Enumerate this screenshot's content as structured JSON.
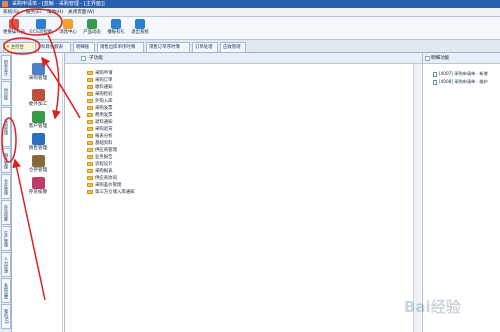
{
  "window": {
    "title": "采购申请单 - [蓝鲸 - 采购管理 - [主界面]]"
  },
  "menu": {
    "items": [
      "系统(S)",
      "服务(E)",
      "帮助(H)",
      "关闭页面(W)"
    ]
  },
  "toolbar": {
    "buttons": [
      {
        "label": "更换操作员",
        "icon": "user-switch-icon",
        "color": "#d9534f"
      },
      {
        "label": "ECS流程图",
        "icon": "flowchart-icon",
        "color": "#2c7fd1"
      },
      {
        "label": "消息中心",
        "icon": "message-icon",
        "color": "#f0a030"
      },
      {
        "label": "产品动态",
        "icon": "news-icon",
        "color": "#3a9a4a"
      },
      {
        "label": "播报有礼",
        "icon": "gift-icon",
        "color": "#2c7fd1"
      },
      {
        "label": "退出系统",
        "icon": "exit-icon",
        "color": "#2c7fd1"
      }
    ]
  },
  "tabs": [
    {
      "label": "主控台",
      "active": true
    },
    {
      "label": "科目余额表",
      "active": false
    },
    {
      "label": "明细账",
      "active": false
    },
    {
      "label": "销售出库单序时簿",
      "active": false
    },
    {
      "label": "销售订单序时簿",
      "active": false
    },
    {
      "label": "订单处理",
      "active": false
    },
    {
      "label": "应收管理",
      "active": false
    }
  ],
  "side_tabs": [
    {
      "label": "财务会计",
      "active": false
    },
    {
      "label": "供应链",
      "active": false
    },
    {
      "label": "采购管理",
      "active": true
    },
    {
      "label": "销售管理",
      "active": false
    },
    {
      "label": "仓存管理",
      "active": false
    },
    {
      "label": "存货核算",
      "active": false
    },
    {
      "label": "生产管理",
      "active": false
    },
    {
      "label": "人力资源",
      "active": false
    },
    {
      "label": "系统设置",
      "active": false
    },
    {
      "label": "我的K/3",
      "active": false
    }
  ],
  "modules": [
    {
      "label": "采购管理",
      "icon": "purchase-icon",
      "color": "#4a7fc8"
    },
    {
      "label": "委外加工",
      "icon": "outsource-icon",
      "color": "#c0503a"
    },
    {
      "label": "客户管理",
      "icon": "customer-icon",
      "color": "#3a9a4a"
    },
    {
      "label": "销售管理",
      "icon": "sales-icon",
      "color": "#2c6fc0"
    },
    {
      "label": "仓存管理",
      "icon": "warehouse-icon",
      "color": "#8a6a3a"
    },
    {
      "label": "存货核算",
      "icon": "inventory-icon",
      "color": "#c03a6a"
    }
  ],
  "middle_pane": {
    "header": "子功能",
    "items": [
      "采购申请",
      "采购订单",
      "收料通知",
      "采购检验",
      "外购入库",
      "采购发票",
      "费用发票",
      "退料通知",
      "采购退货",
      "报表分析",
      "基础资料",
      "供应商管理",
      "业务报告",
      "流程设计",
      "采购报表",
      "供应商协同",
      "采购差价管理",
      "第三方仓储入库通知"
    ]
  },
  "right_pane": {
    "header": "明细功能",
    "items": [
      "[4007] 采购申请单 - 新增",
      "[4008] 采购申请单 - 维护"
    ]
  },
  "watermark": "Bai经验"
}
